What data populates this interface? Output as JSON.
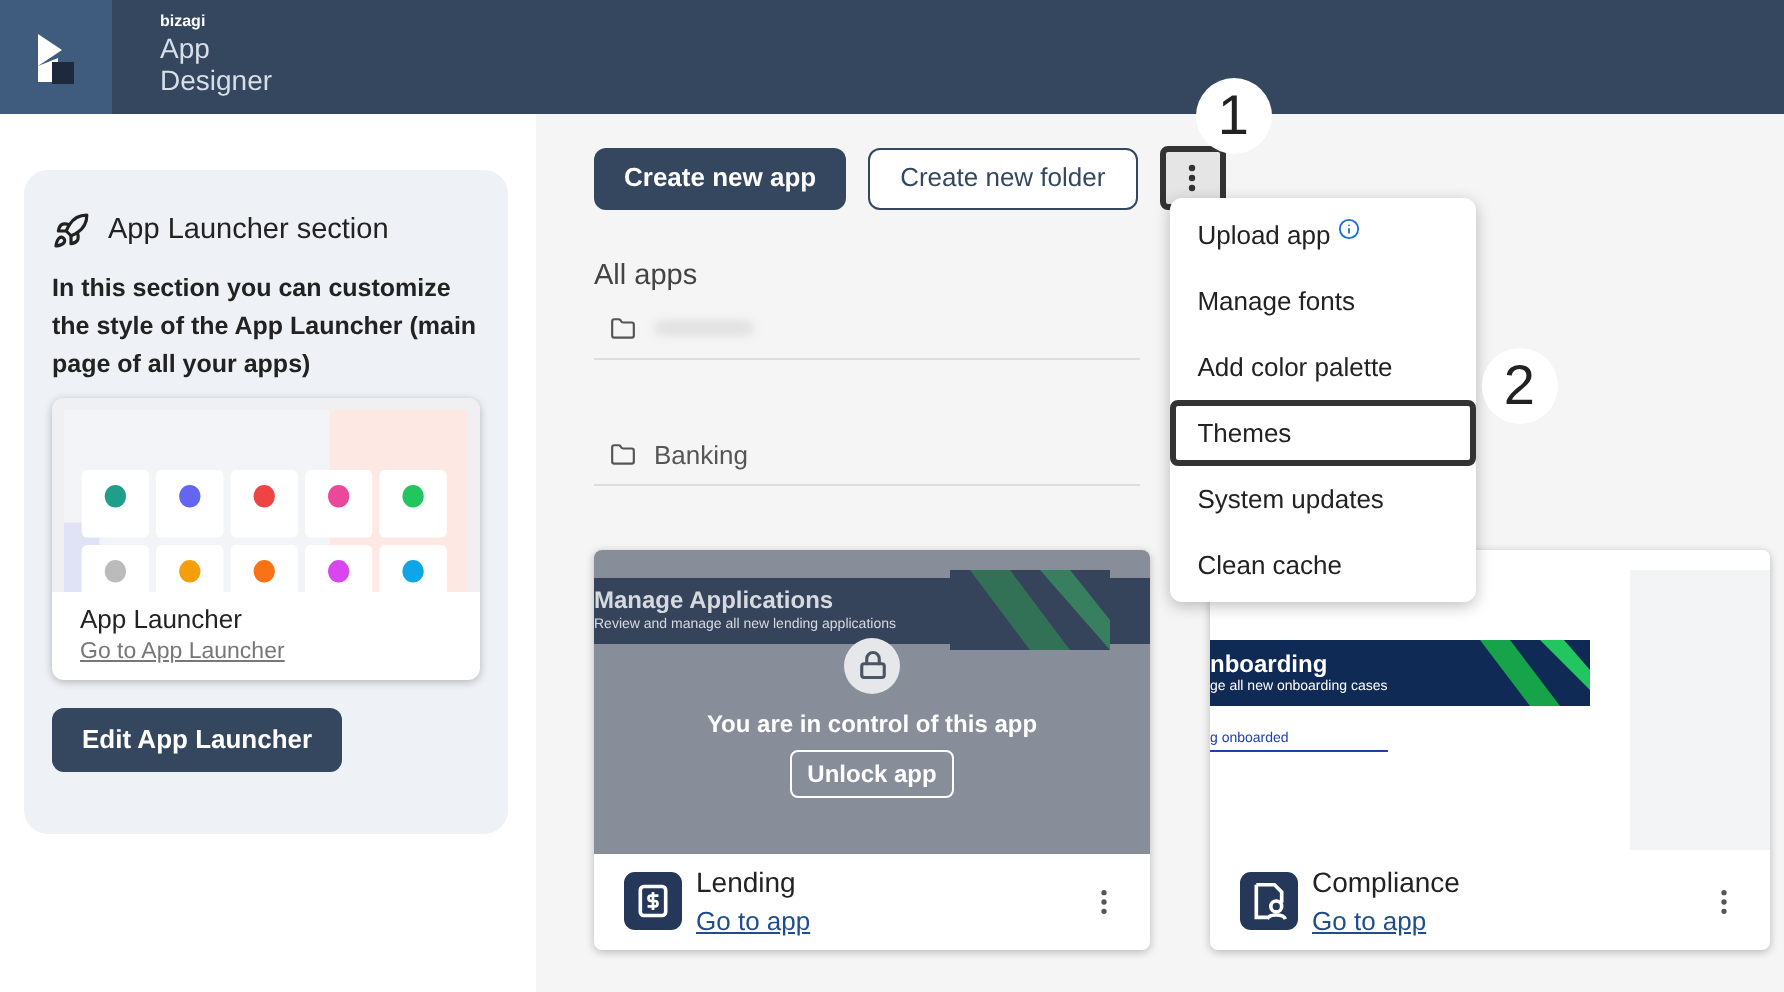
{
  "header": {
    "brand": "bizagi",
    "title_line_1": "App",
    "title_line_2": "Designer"
  },
  "launcher_panel": {
    "title": "App Launcher section",
    "description": "In this section you can customize the style of the App Launcher (main page of all your apps)",
    "preview_card": {
      "name": "App Launcher",
      "link": "Go to App Launcher"
    },
    "button": "Edit App Launcher"
  },
  "toolbar": {
    "primary_button": "Create new app",
    "secondary_button": "Create new folder"
  },
  "more_button": {
    "highlighted": true,
    "callout": "1"
  },
  "more_menu": {
    "expanded": true,
    "items": [
      {
        "label": "Upload app",
        "info": true,
        "highlighted": false
      },
      {
        "label": "Manage fonts",
        "info": false,
        "highlighted": false
      },
      {
        "label": "Add color palette",
        "info": false,
        "highlighted": false
      },
      {
        "label": "Themes",
        "info": false,
        "highlighted": true,
        "callout": "2"
      },
      {
        "label": "System updates",
        "info": false,
        "highlighted": false
      },
      {
        "label": "Clean cache",
        "info": false,
        "highlighted": false
      }
    ]
  },
  "section_title": "All apps",
  "folders": [
    {
      "kind": "redacted"
    },
    {
      "kind": "folder",
      "name": "Banking"
    }
  ],
  "apps": [
    {
      "name": "Lending",
      "link": "Go to app",
      "locked": true,
      "lock_message": "You are in control of this app",
      "unlock_button": "Unlock app",
      "preview": {
        "title": "Manage Applications",
        "subtitle": "Review and manage all new lending applications"
      }
    },
    {
      "name": "Compliance",
      "link": "Go to app",
      "locked": false,
      "preview": {
        "title": "nboarding",
        "subtitle": "ge all new onboarding cases",
        "tab": "g onboarded"
      }
    }
  ]
}
